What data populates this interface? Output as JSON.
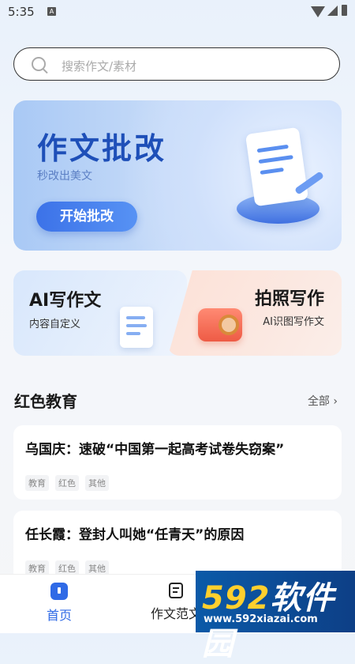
{
  "status_bar": {
    "time": "5:35",
    "badge": "A"
  },
  "search": {
    "placeholder": "搜索作文/素材"
  },
  "hero": {
    "title": "作文批改",
    "subtitle": "秒改出美文",
    "button": "开始批改"
  },
  "cards": {
    "ai": {
      "title": "AI写作文",
      "subtitle": "内容自定义"
    },
    "photo": {
      "title": "拍照写作",
      "subtitle": "AI识图写作文"
    }
  },
  "section": {
    "title": "红色教育",
    "all": "全部 ›"
  },
  "articles": [
    {
      "title": "乌国庆：速破“中国第一起高考试卷失窃案”",
      "tags": [
        "教育",
        "红色",
        "其他"
      ]
    },
    {
      "title": "任长霞：登封人叫她“任青天”的原因",
      "tags": [
        "教育",
        "红色",
        "其他"
      ]
    }
  ],
  "tabs": [
    {
      "label": "首页"
    },
    {
      "label": "作文范文"
    }
  ],
  "watermark": {
    "brand_num": "592",
    "brand_text": "软件园",
    "url": "www.592xiazai.com"
  },
  "colors": {
    "accent": "#2f6ae6",
    "hero_title": "#1e4fb8"
  }
}
